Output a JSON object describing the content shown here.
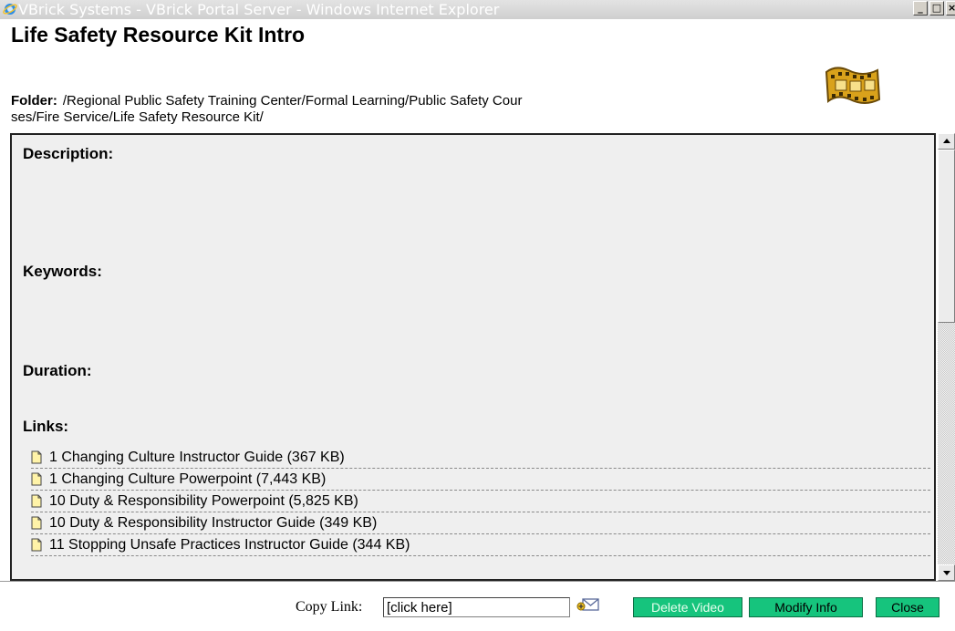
{
  "window": {
    "title": "VBrick Systems - VBrick Portal Server - Windows Internet Explorer",
    "minimize": "_",
    "maximize": "□",
    "close": "×"
  },
  "header": {
    "title": "Life Safety Resource Kit Intro",
    "folder_label": "Folder:",
    "folder_path_line1": "/Regional Public Safety Training Center/Formal Learning/Public Safety Cour",
    "folder_path_line2": "ses/Fire Service/Life Safety Resource Kit/"
  },
  "details": {
    "description_label": "Description:",
    "keywords_label": "Keywords:",
    "duration_label": "Duration:",
    "links_label": "Links:",
    "links": [
      "1 Changing Culture Instructor Guide (367 KB)",
      "1 Changing Culture Powerpoint (7,443 KB)",
      "10 Duty & Responsibility Powerpoint (5,825 KB)",
      "10 Duty & Responsibility Instructor Guide (349 KB)",
      "11 Stopping Unsafe Practices Instructor Guide (344 KB)"
    ]
  },
  "footer": {
    "copy_link_label": "Copy Link:",
    "copy_link_value": "[click here]",
    "delete_button": "Delete Video",
    "modify_button": "Modify Info",
    "close_button": "Close"
  },
  "colors": {
    "button_green": "#16c47d",
    "content_bg": "#efefef"
  },
  "icons": {
    "browser": "ie-icon",
    "media": "film-reel-icon",
    "link_item": "document-icon",
    "email": "email-icon"
  }
}
